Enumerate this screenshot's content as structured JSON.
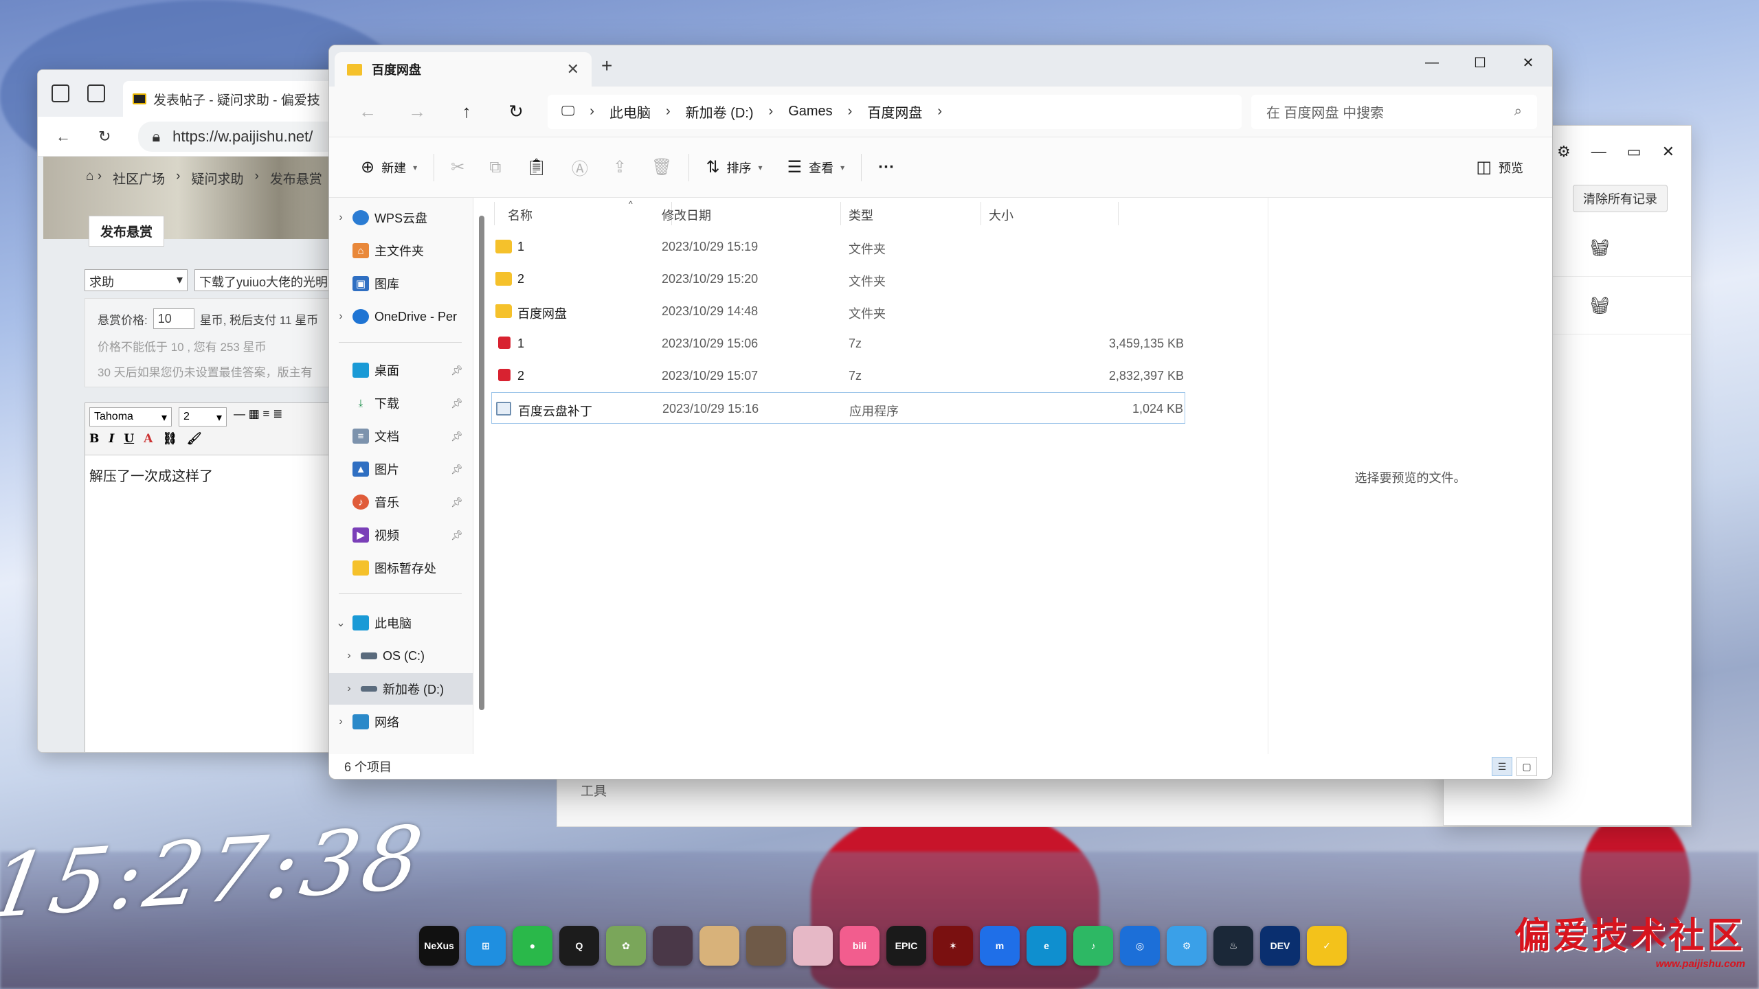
{
  "browser": {
    "tab_title": "发表帖子 - 疑问求助 - 偏爱技",
    "url": "https://w.paijishu.net/",
    "breadcrumbs": [
      "社区广场",
      "疑问求助",
      "发布悬赏"
    ],
    "publish_tab": "发布悬赏",
    "category_select": "求助",
    "subject_value": "下载了yuiuo大佬的光明",
    "bounty_label": "悬赏价格:",
    "bounty_value": "10",
    "bounty_after": "星币, 税后支付 11 星币",
    "bounty_hint1": "价格不能低于 10 , 您有 253 星币",
    "bounty_hint2": "30 天后如果您仍未设置最佳答案，版主有",
    "font_select": "Tahoma",
    "size_select": "2",
    "editor_text": "解压了一次成这样了"
  },
  "explorer": {
    "tab_title": "百度网盘",
    "breadcrumb": [
      "此电脑",
      "新加卷 (D:)",
      "Games",
      "百度网盘"
    ],
    "search_placeholder": "在 百度网盘 中搜索",
    "commands": {
      "new": "新建",
      "sort": "排序",
      "view": "查看",
      "more": "···",
      "preview": "预览"
    },
    "sidebar": {
      "wps": "WPS云盘",
      "home": "主文件夹",
      "gallery": "图库",
      "onedrive": "OneDrive - Per",
      "desktop": "桌面",
      "downloads": "下载",
      "documents": "文档",
      "pictures": "图片",
      "music": "音乐",
      "videos": "视频",
      "iconstore": "图标暂存处",
      "thispc": "此电脑",
      "osc": "OS (C:)",
      "newd": "新加卷 (D:)",
      "network": "网络"
    },
    "columns": {
      "name": "名称",
      "modified": "修改日期",
      "type": "类型",
      "size": "大小"
    },
    "files": [
      {
        "name": "1",
        "modified": "2023/10/29 15:19",
        "type": "文件夹",
        "size": "",
        "icon": "folder-icon"
      },
      {
        "name": "2",
        "modified": "2023/10/29 15:20",
        "type": "文件夹",
        "size": "",
        "icon": "folder-icon"
      },
      {
        "name": "百度网盘",
        "modified": "2023/10/29 14:48",
        "type": "文件夹",
        "size": "",
        "icon": "folder-icon"
      },
      {
        "name": "1",
        "modified": "2023/10/29 15:06",
        "type": "7z",
        "size": "3,459,135 KB",
        "icon": "archive-icon"
      },
      {
        "name": "2",
        "modified": "2023/10/29 15:07",
        "type": "7z",
        "size": "2,832,397 KB",
        "icon": "archive-icon"
      },
      {
        "name": "百度云盘补丁",
        "modified": "2023/10/29 15:16",
        "type": "应用程序",
        "size": "1,024 KB",
        "icon": "app-icon"
      }
    ],
    "preview_message": "选择要预览的文件。",
    "status": "6 个项目"
  },
  "right_window": {
    "clear_button": "清除所有记录"
  },
  "tools_label": "工具",
  "clock": "15:27:38",
  "dock_apps": [
    "NeXus",
    "Windows",
    "WeChat",
    "QQ",
    "Tortoise",
    "Game1",
    "Game2",
    "Game3",
    "Game4",
    "bilibili",
    "EPIC",
    "NARAKA",
    "Meeting",
    "Edge",
    "Music",
    "Camera",
    "Gear",
    "Steam",
    "DEV",
    "Colors"
  ],
  "brand": {
    "title": "偏爱技术社区",
    "url": "www.paijishu.com"
  }
}
